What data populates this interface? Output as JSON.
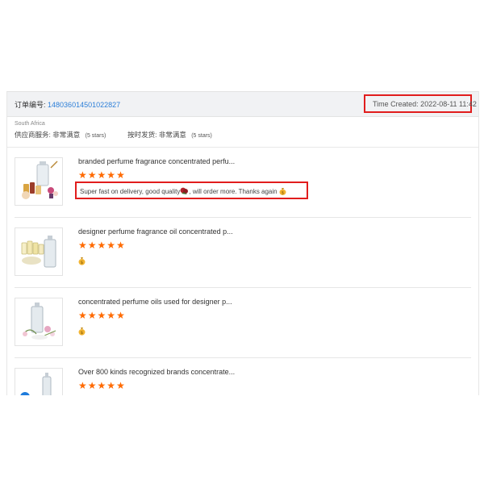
{
  "order": {
    "number_label": "订单编号:",
    "number_value": "148036014501022827",
    "time_created": "Time Created: 2022-08-11 11:42"
  },
  "buyer": {
    "country": "South Africa",
    "supplier_service_label": "供应商服务:",
    "supplier_service_value": "非常满意",
    "supplier_service_stars": "(5 stars)",
    "shipping_label": "按时发货:",
    "shipping_value": "非常满意",
    "shipping_stars": "(5 stars)"
  },
  "products": [
    {
      "title": "branded perfume fragrance concentrated perfu...",
      "rating": 5,
      "review_part1": "Super fast on delivery, good quality",
      "review_part2": ", will order more. Thanks again",
      "review_emojis": [
        "rose-emoji",
        "money-bag-emoji"
      ]
    },
    {
      "title": "designer perfume fragrance oil concentrated p...",
      "rating": 5,
      "review_emojis": [
        "money-bag-emoji"
      ]
    },
    {
      "title": "concentrated perfume oils used for designer p...",
      "rating": 5,
      "review_emojis": [
        "money-bag-emoji"
      ]
    },
    {
      "title": "Over 800 kinds recognized brands concentrate...",
      "rating": 5,
      "review_emojis": []
    }
  ],
  "colors": {
    "star": "#ff6a00",
    "highlight_border": "#e11d1d",
    "link_blue": "#2d7fd8",
    "header_bg": "#f1f2f4"
  }
}
